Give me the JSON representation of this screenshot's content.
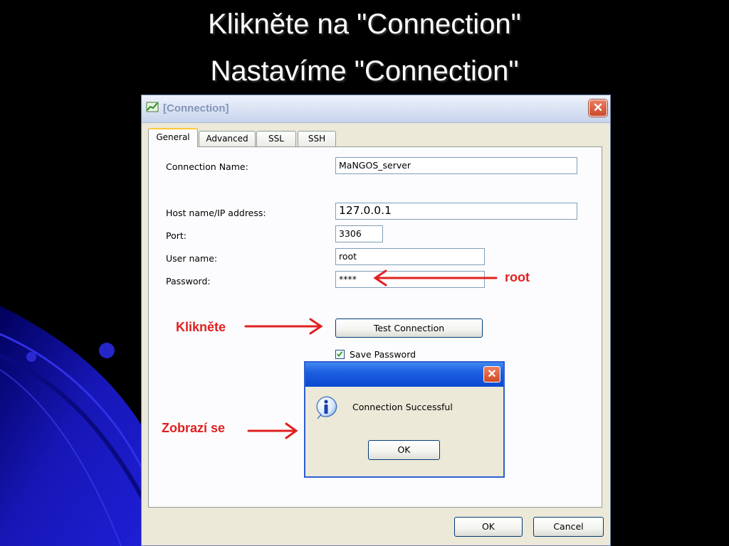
{
  "slide": {
    "title_line1": "Klikněte na \"Connection\"",
    "title_line2": "Nastavíme \"Connection\""
  },
  "window": {
    "title": "[Connection]",
    "close_glyph": "✕",
    "tabs": [
      {
        "label": "General",
        "active": true
      },
      {
        "label": "Advanced",
        "active": false
      },
      {
        "label": "SSL",
        "active": false
      },
      {
        "label": "SSH",
        "active": false
      }
    ],
    "form": {
      "connection_name_label": "Connection Name:",
      "connection_name_value": "MaNGOS_server",
      "host_label": "Host name/IP address:",
      "host_value": "127.0.0.1",
      "port_label": "Port:",
      "port_value": "3306",
      "user_label": "User name:",
      "user_value": "root",
      "password_label": "Password:",
      "password_value": "****",
      "save_password_label": "Save Password",
      "save_password_checked": true,
      "test_button_label": "Test Connection"
    },
    "buttons": {
      "ok": "OK",
      "cancel": "Cancel"
    }
  },
  "message_box": {
    "close_glyph": "✕",
    "icon": "info-icon",
    "text": "Connection Successful",
    "ok_label": "OK"
  },
  "annotations": {
    "root": "root",
    "kliknete": "Klikněte",
    "zobrazi": "Zobrazí se",
    "color": "#e02020"
  },
  "colors": {
    "slide_bg": "#000000",
    "swirl": "#1a1ab8",
    "window_bg": "#ece9d8",
    "xp_blue": "#0a49d0",
    "close_red": "#c94a2a"
  }
}
